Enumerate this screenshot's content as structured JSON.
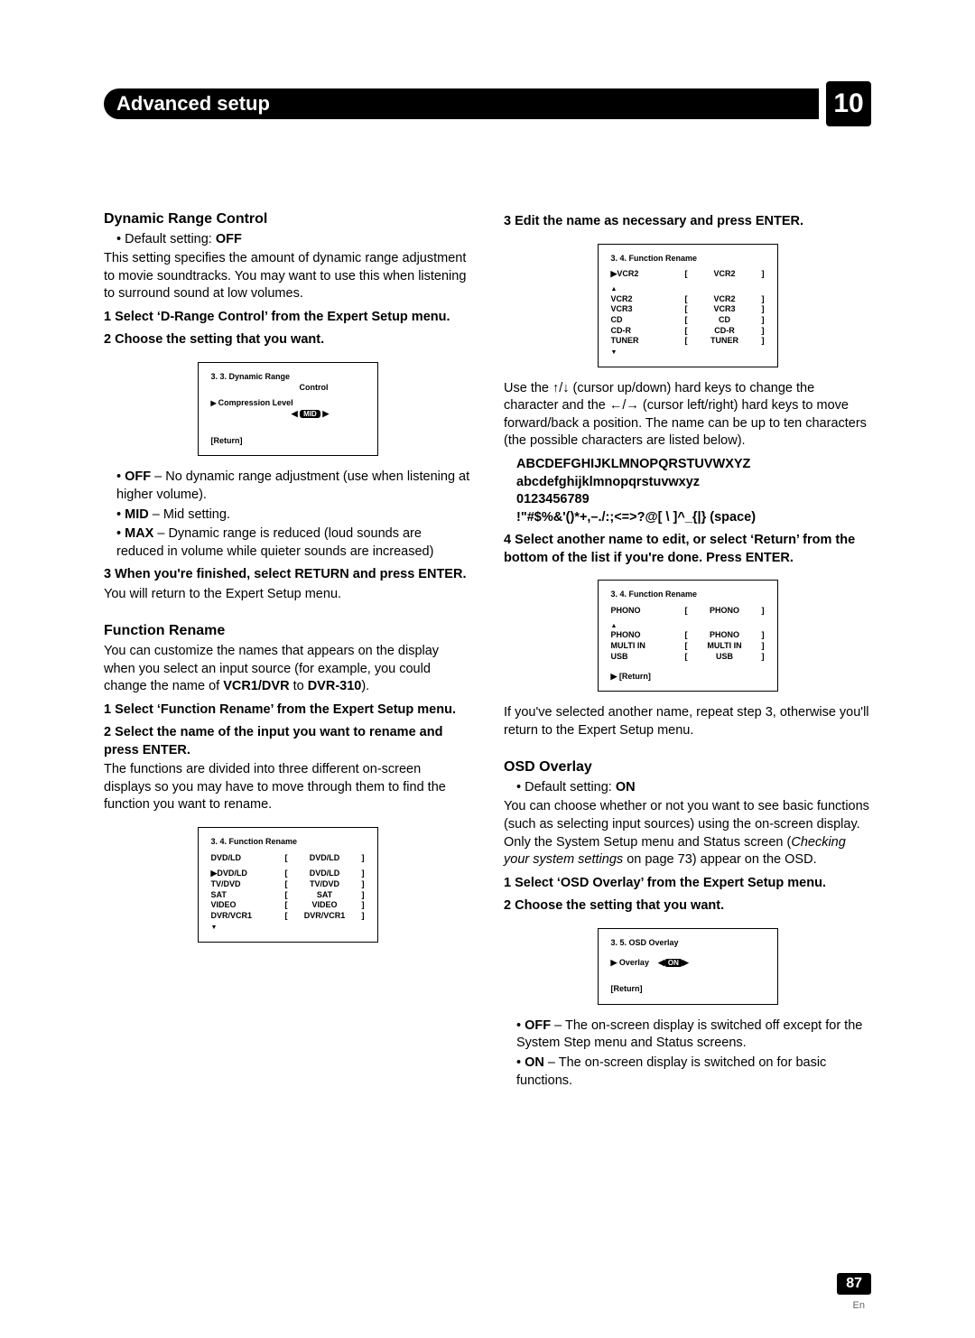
{
  "header": {
    "title": "Advanced setup",
    "chapter": "10"
  },
  "drc": {
    "title": "Dynamic Range Control",
    "default": "Default setting: ",
    "default_val": "OFF",
    "intro": "This setting specifies the amount of dynamic range adjustment to movie soundtracks. You may want to use this when listening to surround sound at low volumes.",
    "step1": "1   Select ‘D-Range Control’ from the Expert Setup menu.",
    "step2": "2   Choose the setting that you want.",
    "osd": {
      "title": "3. 3. Dynamic  Range",
      "sub": "Control",
      "line": "Compression Level",
      "val": "MID",
      "ret": "[Return]"
    },
    "b1a": "OFF",
    "b1b": " – No dynamic range adjustment (use when listening at higher volume).",
    "b2a": "MID",
    "b2b": " – Mid setting.",
    "b3a": "MAX",
    "b3b": " – Dynamic range is reduced (loud sounds are reduced in volume while quieter sounds are increased)",
    "step3": "3   When you're finished, select RETURN and press ENTER.",
    "outro": "You will return to the Expert Setup menu."
  },
  "fr": {
    "title": "Function Rename",
    "intro1": "You can customize the names that appears on the display when you select an input source (for example, you could change the name of ",
    "intro_b1": "VCR1/DVR",
    "intro_mid": " to ",
    "intro_b2": "DVR-310",
    "intro_end": ").",
    "step1": "1   Select ‘Function Rename’ from the Expert Setup menu.",
    "step2": "2   Select the name of the input you want to rename and press ENTER.",
    "step2txt": "The functions are divided into three different on-screen displays so you may have to move through them to find the function you want to rename.",
    "osd1": {
      "title": "3. 4. Function  Rename",
      "top": [
        "DVD/LD",
        "[",
        "DVD/LD",
        "]"
      ],
      "rows": [
        [
          "▶DVD/LD",
          "[",
          "DVD/LD",
          "]"
        ],
        [
          "TV/DVD",
          "[",
          "TV/DVD",
          "]"
        ],
        [
          "SAT",
          "[",
          "SAT",
          "]"
        ],
        [
          "VIDEO",
          "[",
          "VIDEO",
          "]"
        ],
        [
          "DVR/VCR1",
          "[",
          "DVR/VCR1",
          "]"
        ]
      ]
    }
  },
  "right": {
    "step3": "3   Edit the name as necessary and press ENTER.",
    "osd2": {
      "title": "3. 4. Function  Rename",
      "top": [
        "▶VCR2",
        "[",
        "VCR2",
        "]"
      ],
      "rows": [
        [
          "VCR2",
          "[",
          "VCR2",
          "]"
        ],
        [
          "VCR3",
          "[",
          "VCR3",
          "]"
        ],
        [
          "CD",
          "[",
          "CD",
          "]"
        ],
        [
          "CD-R",
          "[",
          "CD-R",
          "]"
        ],
        [
          "TUNER",
          "[",
          "TUNER",
          "]"
        ]
      ]
    },
    "para": "Use the ↑/↓ (cursor up/down) hard keys to change the character and the ←/→ (cursor left/right) hard keys to move forward/back a position. The name can be up to ten characters (the possible characters are listed below).",
    "chars1": "ABCDEFGHIJKLMNOPQRSTUVWXYZ",
    "chars2": "abcdefghijklmnopqrstuvwxyz",
    "chars3": "0123456789",
    "chars4": "!\"#$%&'()*+,–./:;<=>?@[ \\ ]^_{|} (space)",
    "step4": "4   Select another name to edit, or select ‘Return’ from the bottom of the list if you're done. Press ENTER.",
    "osd3": {
      "title": "3. 4. Function  Rename",
      "top": [
        "PHONO",
        "[",
        "PHONO",
        "]"
      ],
      "rows": [
        [
          "PHONO",
          "[",
          "PHONO",
          "]"
        ],
        [
          "MULTI   IN",
          "[",
          "MULTI   IN",
          "]"
        ],
        [
          "USB",
          "[",
          "USB",
          "]"
        ]
      ],
      "ret": "▶ [Return]"
    },
    "outro": "If you've selected another name, repeat step 3, otherwise you'll return to the Expert Setup menu."
  },
  "osdov": {
    "title": "OSD Overlay",
    "default": "Default setting: ",
    "default_val": "ON",
    "intro1": "You can choose whether or not you want to see basic functions (such as selecting input sources) using the on-screen display. Only the System Setup menu and Status screen (",
    "intro_em": "Checking your system settings",
    "intro2": " on page 73) appear on the OSD.",
    "step1": "1   Select ‘OSD Overlay’ from the Expert Setup menu.",
    "step2": "2   Choose the setting that you want.",
    "osd": {
      "title": "3. 5. OSD Overlay",
      "line": "▶ Overlay",
      "val": "ON",
      "ret": "[Return]"
    },
    "b1a": "OFF",
    "b1b": " – The on-screen display is switched off except for the System Step menu and Status screens.",
    "b2a": "ON",
    "b2b": " – The on-screen display is switched on for basic functions."
  },
  "page": {
    "num": "87",
    "lang": "En"
  }
}
